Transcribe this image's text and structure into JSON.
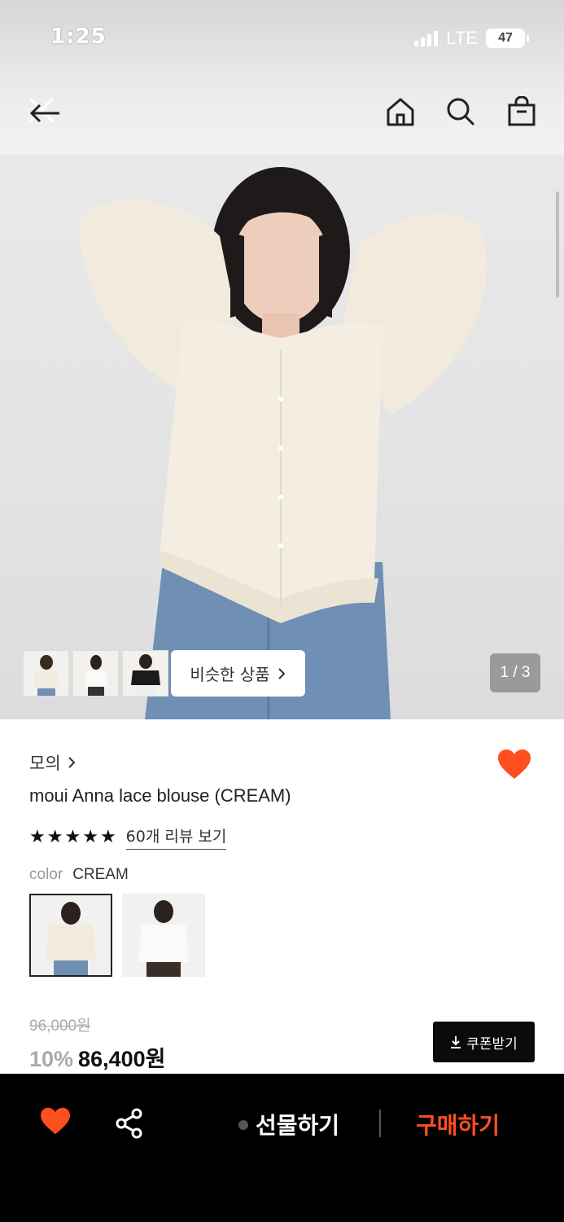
{
  "status_bar": {
    "time": "1:25",
    "network": "LTE",
    "battery": "47"
  },
  "header": {
    "icons": [
      "close-icon",
      "back-arrow-icon",
      "home-icon",
      "search-icon",
      "shopping-bag-icon"
    ]
  },
  "gallery": {
    "similar_label": "비슷한 상품",
    "page_indicator": "1 / 3"
  },
  "product": {
    "brand": "모의",
    "name": "moui Anna lace blouse (CREAM)",
    "rating_stars": 5,
    "review_link": "60개 리뷰 보기",
    "color_label": "color",
    "color_value": "CREAM",
    "original_price": "96,000원",
    "discount": "10%",
    "sale_price": "86,400원",
    "coupon_label": "쿠폰받기"
  },
  "bottom_bar": {
    "gift_label": "선물하기",
    "buy_label": "구매하기"
  },
  "colors": {
    "accent": "#ff4e1f",
    "heart": "#ff4e1f",
    "bar_bg": "#000000"
  }
}
